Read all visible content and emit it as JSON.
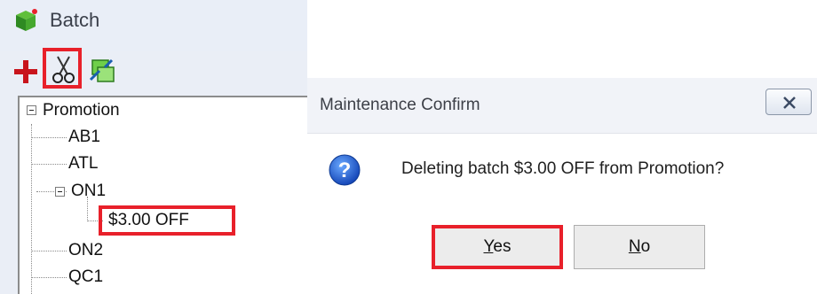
{
  "batch_panel": {
    "title": "Batch",
    "toolbar": {
      "add_icon": "plus-icon",
      "cut_icon": "scissors-icon",
      "swap_icon": "swap-icon"
    },
    "tree": {
      "root": "Promotion",
      "children": [
        "AB1",
        "ATL",
        "ON1",
        "ON2",
        "QC1"
      ],
      "on1_children": [
        "$3.00 OFF"
      ]
    }
  },
  "dialog": {
    "title": "Maintenance Confirm",
    "message": "Deleting batch $3.00 OFF from Promotion?",
    "yes": {
      "mnemonic": "Y",
      "rest": "es"
    },
    "no": {
      "mnemonic": "N",
      "rest": "o"
    },
    "close_icon": "close-icon",
    "question_icon": "question-icon"
  },
  "colors": {
    "highlight": "#e8202a",
    "panel": "#eaeef6",
    "dialog_title": "#f1f3f8"
  }
}
